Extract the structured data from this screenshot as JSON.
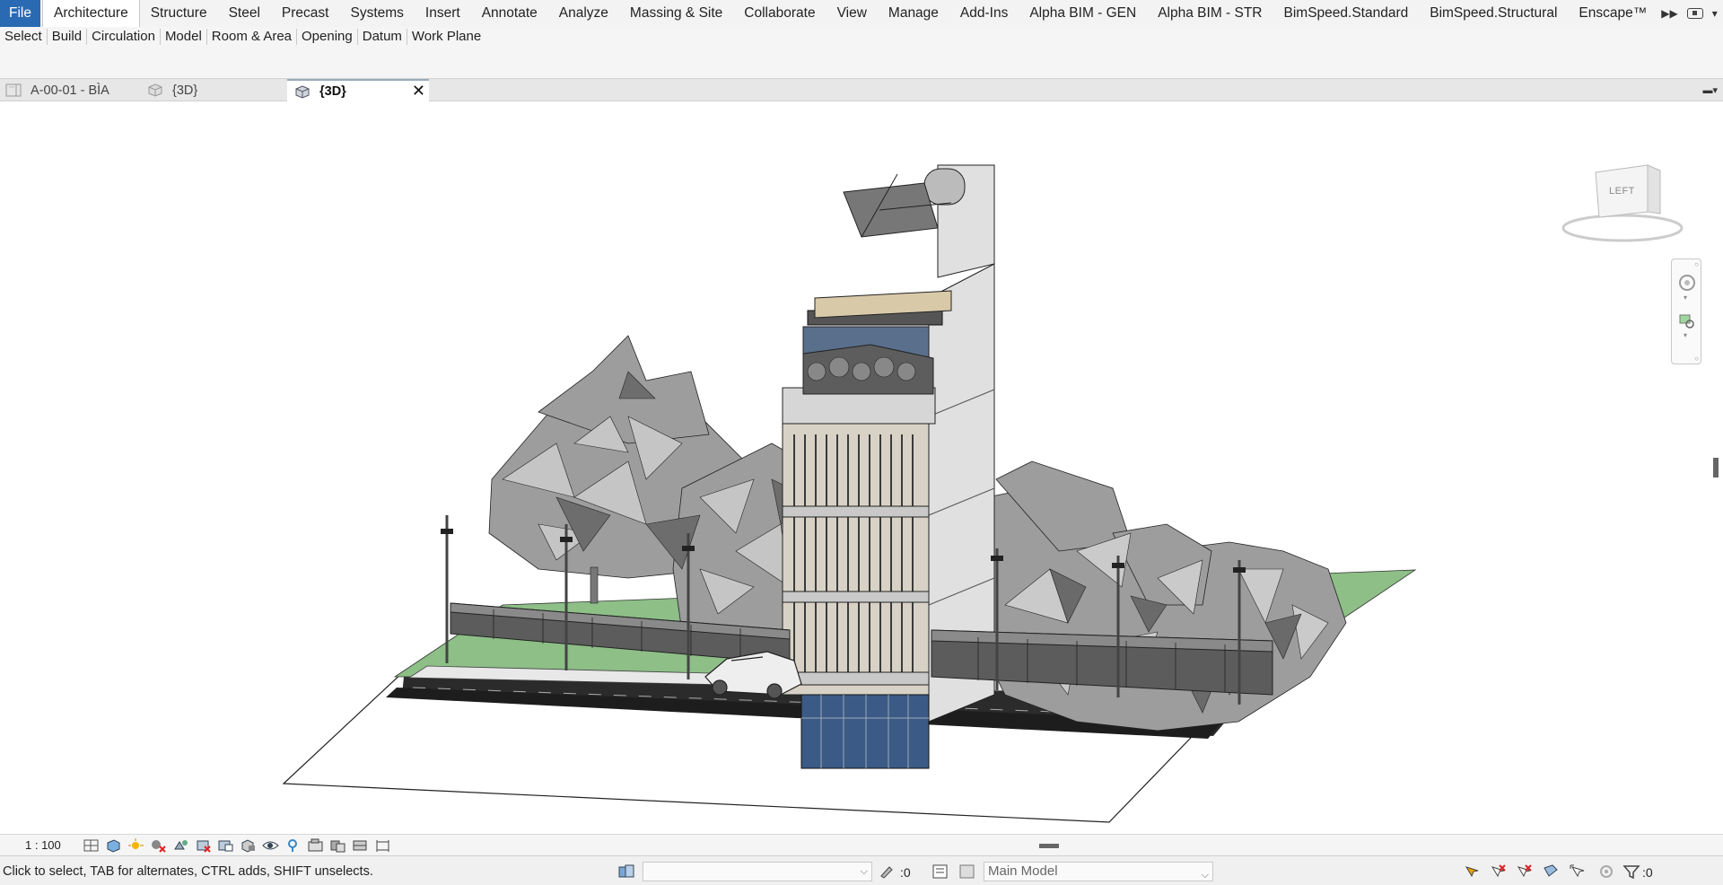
{
  "ribbon": {
    "file_label": "File",
    "tabs": [
      "Architecture",
      "Structure",
      "Steel",
      "Precast",
      "Systems",
      "Insert",
      "Annotate",
      "Analyze",
      "Massing & Site",
      "Collaborate",
      "View",
      "Manage",
      "Add-Ins",
      "Alpha BIM - GEN",
      "Alpha BIM - STR",
      "BimSpeed.Standard",
      "BimSpeed.Structural",
      "Enscape™"
    ],
    "active_tab": "Architecture",
    "panels": [
      "Select",
      "Build",
      "Circulation",
      "Model",
      "Room & Area",
      "Opening",
      "Datum",
      "Work Plane"
    ]
  },
  "doc_tabs": [
    {
      "label": "A-00-01 - BÌA",
      "icon": "sheet-icon",
      "active": false
    },
    {
      "label": "{3D}",
      "icon": "3d-view-icon",
      "active": false
    },
    {
      "label": "{3D}",
      "icon": "3d-view-icon",
      "active": true
    }
  ],
  "viewcube": {
    "face_label": "LEFT"
  },
  "view_bar": {
    "scale": "1 : 100"
  },
  "status": {
    "hint": "Click to select, TAB for alternates, CTRL adds, SHIFT unselects.",
    "worksets_value": "",
    "editable_count": ":0",
    "design_option": "Main Model",
    "filter_count": ":0"
  },
  "colors": {
    "file_tab": "#2a6ab3",
    "ribbon_bg": "#f3f3f3",
    "grass": "#8dbf87",
    "road": "#2b2b2b"
  }
}
